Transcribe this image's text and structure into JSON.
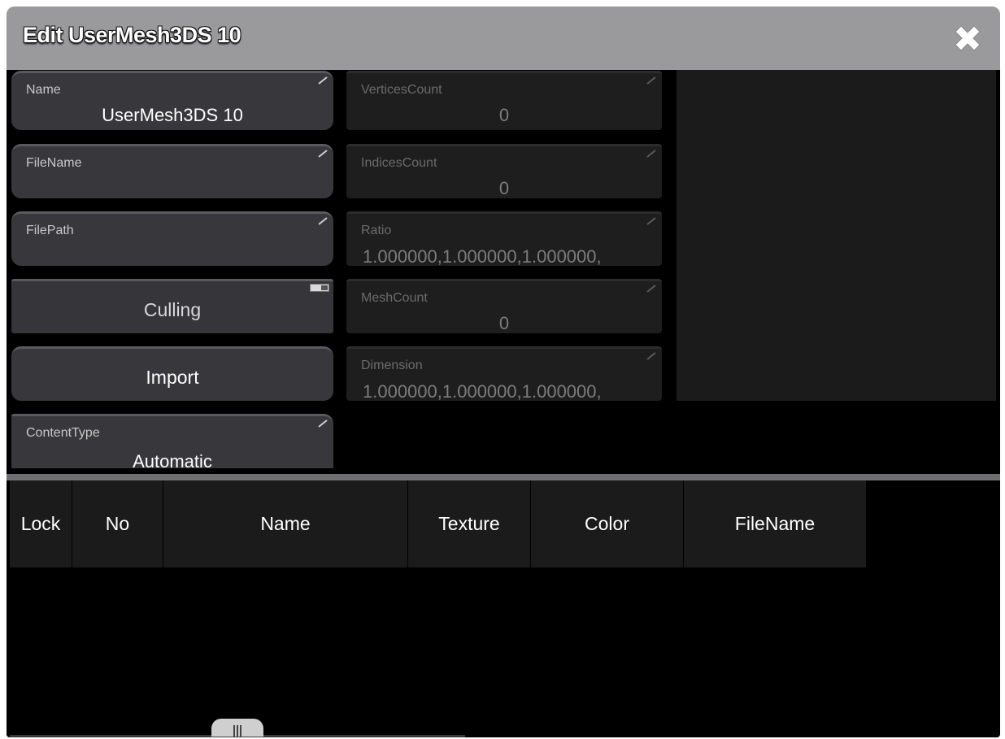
{
  "window": {
    "title": "Edit UserMesh3DS 10"
  },
  "props": {
    "name": {
      "label": "Name",
      "value": "UserMesh3DS 10"
    },
    "filename": {
      "label": "FileName",
      "value": ""
    },
    "filepath": {
      "label": "FilePath",
      "value": ""
    },
    "culling": {
      "label": "Culling"
    },
    "import": {
      "label": "Import"
    },
    "contenttype": {
      "label": "ContentType",
      "value": "Automatic"
    },
    "vertices_count": {
      "label": "VerticesCount",
      "value": "0"
    },
    "indices_count": {
      "label": "IndicesCount",
      "value": "0"
    },
    "ratio": {
      "label": "Ratio",
      "value": "1.000000,1.000000,1.000000,"
    },
    "mesh_count": {
      "label": "MeshCount",
      "value": "0"
    },
    "dimension": {
      "label": "Dimension",
      "value": "1.000000,1.000000,1.000000,"
    }
  },
  "grid": {
    "columns": [
      "Lock",
      "No",
      "Name",
      "Texture",
      "Color",
      "FileName"
    ],
    "rows": []
  },
  "icons": {
    "close": "close-icon",
    "edit": "pencil-corner-icon",
    "toggle": "toggle-icon",
    "resize": "resize-handle-icon"
  },
  "colors": {
    "title_bar": "#9a9a9c",
    "field_bg": "#38383c",
    "readonly_field_bg": "#1e1e1e",
    "grid_header_bg": "#1b1b1b"
  }
}
